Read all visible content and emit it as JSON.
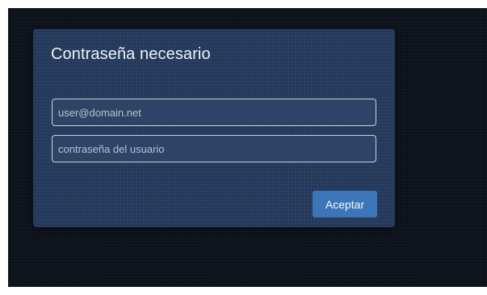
{
  "dialog": {
    "title": "Contraseña necesario",
    "email_field": {
      "value": "",
      "placeholder": "user@domain.net"
    },
    "password_field": {
      "value": "",
      "placeholder": "contraseña del usuario"
    },
    "accept_button_label": "Aceptar"
  },
  "colors": {
    "background": "#0c111a",
    "dialog": "#24395a",
    "accent_button": "#3c76b8"
  }
}
